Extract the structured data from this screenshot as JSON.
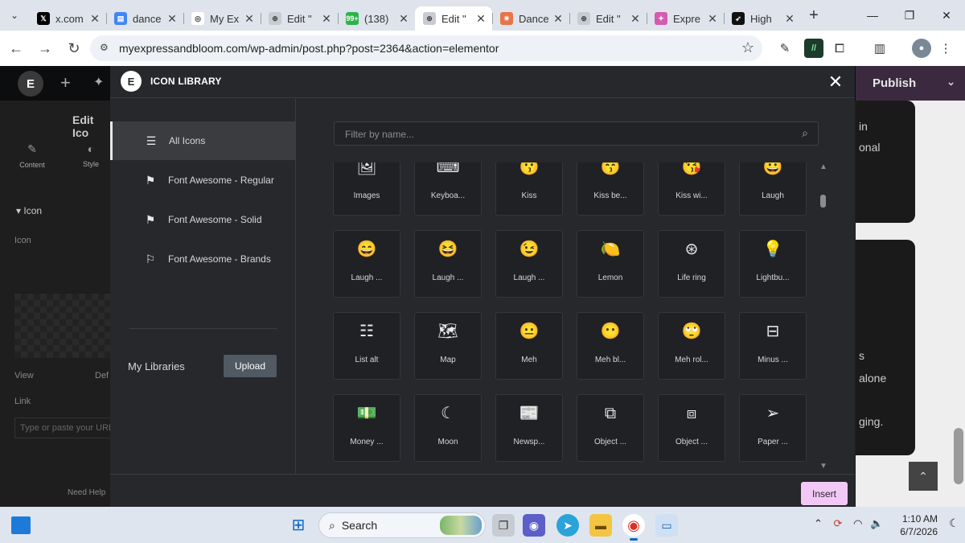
{
  "browser": {
    "tabs": [
      {
        "title": "x.com",
        "favicon_color": "#000000",
        "favicon_glyph": "𝕏"
      },
      {
        "title": "dance",
        "favicon_color": "#4285f4",
        "favicon_glyph": "▤"
      },
      {
        "title": "My Ex",
        "favicon_color": "#ffffff",
        "favicon_glyph": "◎"
      },
      {
        "title": "Edit \"",
        "favicon_color": "#c8ccd2",
        "favicon_glyph": "⊕"
      },
      {
        "title": "(138)",
        "favicon_color": "#2db34a",
        "favicon_glyph": "99+"
      },
      {
        "title": "Edit \"",
        "favicon_color": "#c8ccd2",
        "favicon_glyph": "⊕"
      },
      {
        "title": "Dance",
        "favicon_color": "#e8744a",
        "favicon_glyph": "✷"
      },
      {
        "title": "Edit \"",
        "favicon_color": "#c8ccd2",
        "favicon_glyph": "⊕"
      },
      {
        "title": "Expre",
        "favicon_color": "#d45bb0",
        "favicon_glyph": "✦"
      },
      {
        "title": "High",
        "favicon_color": "#111111",
        "favicon_glyph": "➶"
      }
    ],
    "active_tab_index": 5,
    "url": "myexpressandbloom.com/wp-admin/post.php?post=2364&action=elementor"
  },
  "elementor": {
    "logo": "E",
    "publish_label": "Publish",
    "panel": {
      "title": "Edit Ico",
      "tab_content": "Content",
      "tab_style": "Style",
      "section_icon": "Icon",
      "label_icon": "Icon",
      "label_view": "View",
      "view_value": "Def",
      "label_link": "Link",
      "link_placeholder": "Type or paste your URL",
      "need_help": "Need Help"
    },
    "canvas_snippets": [
      "in",
      "onal",
      "s",
      "alone",
      "ging."
    ]
  },
  "modal": {
    "title": "ICON LIBRARY",
    "logo": "E",
    "close_glyph": "✕",
    "sidebar": [
      {
        "label": "All Icons",
        "icon": "filter-lines-icon",
        "glyph": "☰",
        "active": true
      },
      {
        "label": "Font Awesome - Regular",
        "icon": "flag-outline-icon",
        "glyph": "⚑",
        "active": false
      },
      {
        "label": "Font Awesome - Solid",
        "icon": "flag-solid-icon",
        "glyph": "⚑",
        "active": false
      },
      {
        "label": "Font Awesome - Brands",
        "icon": "flag-brand-icon",
        "glyph": "⚐",
        "active": false
      }
    ],
    "my_libraries": "My Libraries",
    "upload_label": "Upload",
    "filter_placeholder": "Filter by name...",
    "insert_label": "Insert",
    "icons": [
      [
        {
          "name": "Images",
          "icon": "images-icon",
          "glyph": "🖼"
        },
        {
          "name": "Keyboa...",
          "icon": "keyboard-icon",
          "glyph": "⌨"
        },
        {
          "name": "Kiss",
          "icon": "kiss-icon",
          "glyph": "😗"
        },
        {
          "name": "Kiss be...",
          "icon": "kiss-beam-icon",
          "glyph": "😙"
        },
        {
          "name": "Kiss wi...",
          "icon": "kiss-wink-heart-icon",
          "glyph": "😘"
        },
        {
          "name": "Laugh",
          "icon": "laugh-icon",
          "glyph": "😀"
        }
      ],
      [
        {
          "name": "Laugh ...",
          "icon": "laugh-beam-icon",
          "glyph": "😄"
        },
        {
          "name": "Laugh ...",
          "icon": "laugh-squint-icon",
          "glyph": "😆"
        },
        {
          "name": "Laugh ...",
          "icon": "laugh-wink-icon",
          "glyph": "😉"
        },
        {
          "name": "Lemon",
          "icon": "lemon-icon",
          "glyph": "🍋"
        },
        {
          "name": "Life ring",
          "icon": "life-ring-icon",
          "glyph": "⊛"
        },
        {
          "name": "Lightbu...",
          "icon": "lightbulb-icon",
          "glyph": "💡"
        }
      ],
      [
        {
          "name": "List alt",
          "icon": "list-alt-icon",
          "glyph": "☷"
        },
        {
          "name": "Map",
          "icon": "map-icon",
          "glyph": "🗺"
        },
        {
          "name": "Meh",
          "icon": "meh-icon",
          "glyph": "😐"
        },
        {
          "name": "Meh bl...",
          "icon": "meh-blank-icon",
          "glyph": "😶"
        },
        {
          "name": "Meh rol...",
          "icon": "meh-rolling-eyes-icon",
          "glyph": "🙄"
        },
        {
          "name": "Minus ...",
          "icon": "minus-square-icon",
          "glyph": "⊟"
        }
      ],
      [
        {
          "name": "Money ...",
          "icon": "money-bill-icon",
          "glyph": "💵"
        },
        {
          "name": "Moon",
          "icon": "moon-icon",
          "glyph": "☾"
        },
        {
          "name": "Newsp...",
          "icon": "newspaper-icon",
          "glyph": "📰"
        },
        {
          "name": "Object ...",
          "icon": "object-group-icon",
          "glyph": "⧉"
        },
        {
          "name": "Object ...",
          "icon": "object-ungroup-icon",
          "glyph": "⧈"
        },
        {
          "name": "Paper ...",
          "icon": "paper-plane-icon",
          "glyph": "➢"
        }
      ]
    ]
  },
  "taskbar": {
    "search_label": "Search",
    "time": "1:10 AM",
    "date": "6/7/2026"
  }
}
